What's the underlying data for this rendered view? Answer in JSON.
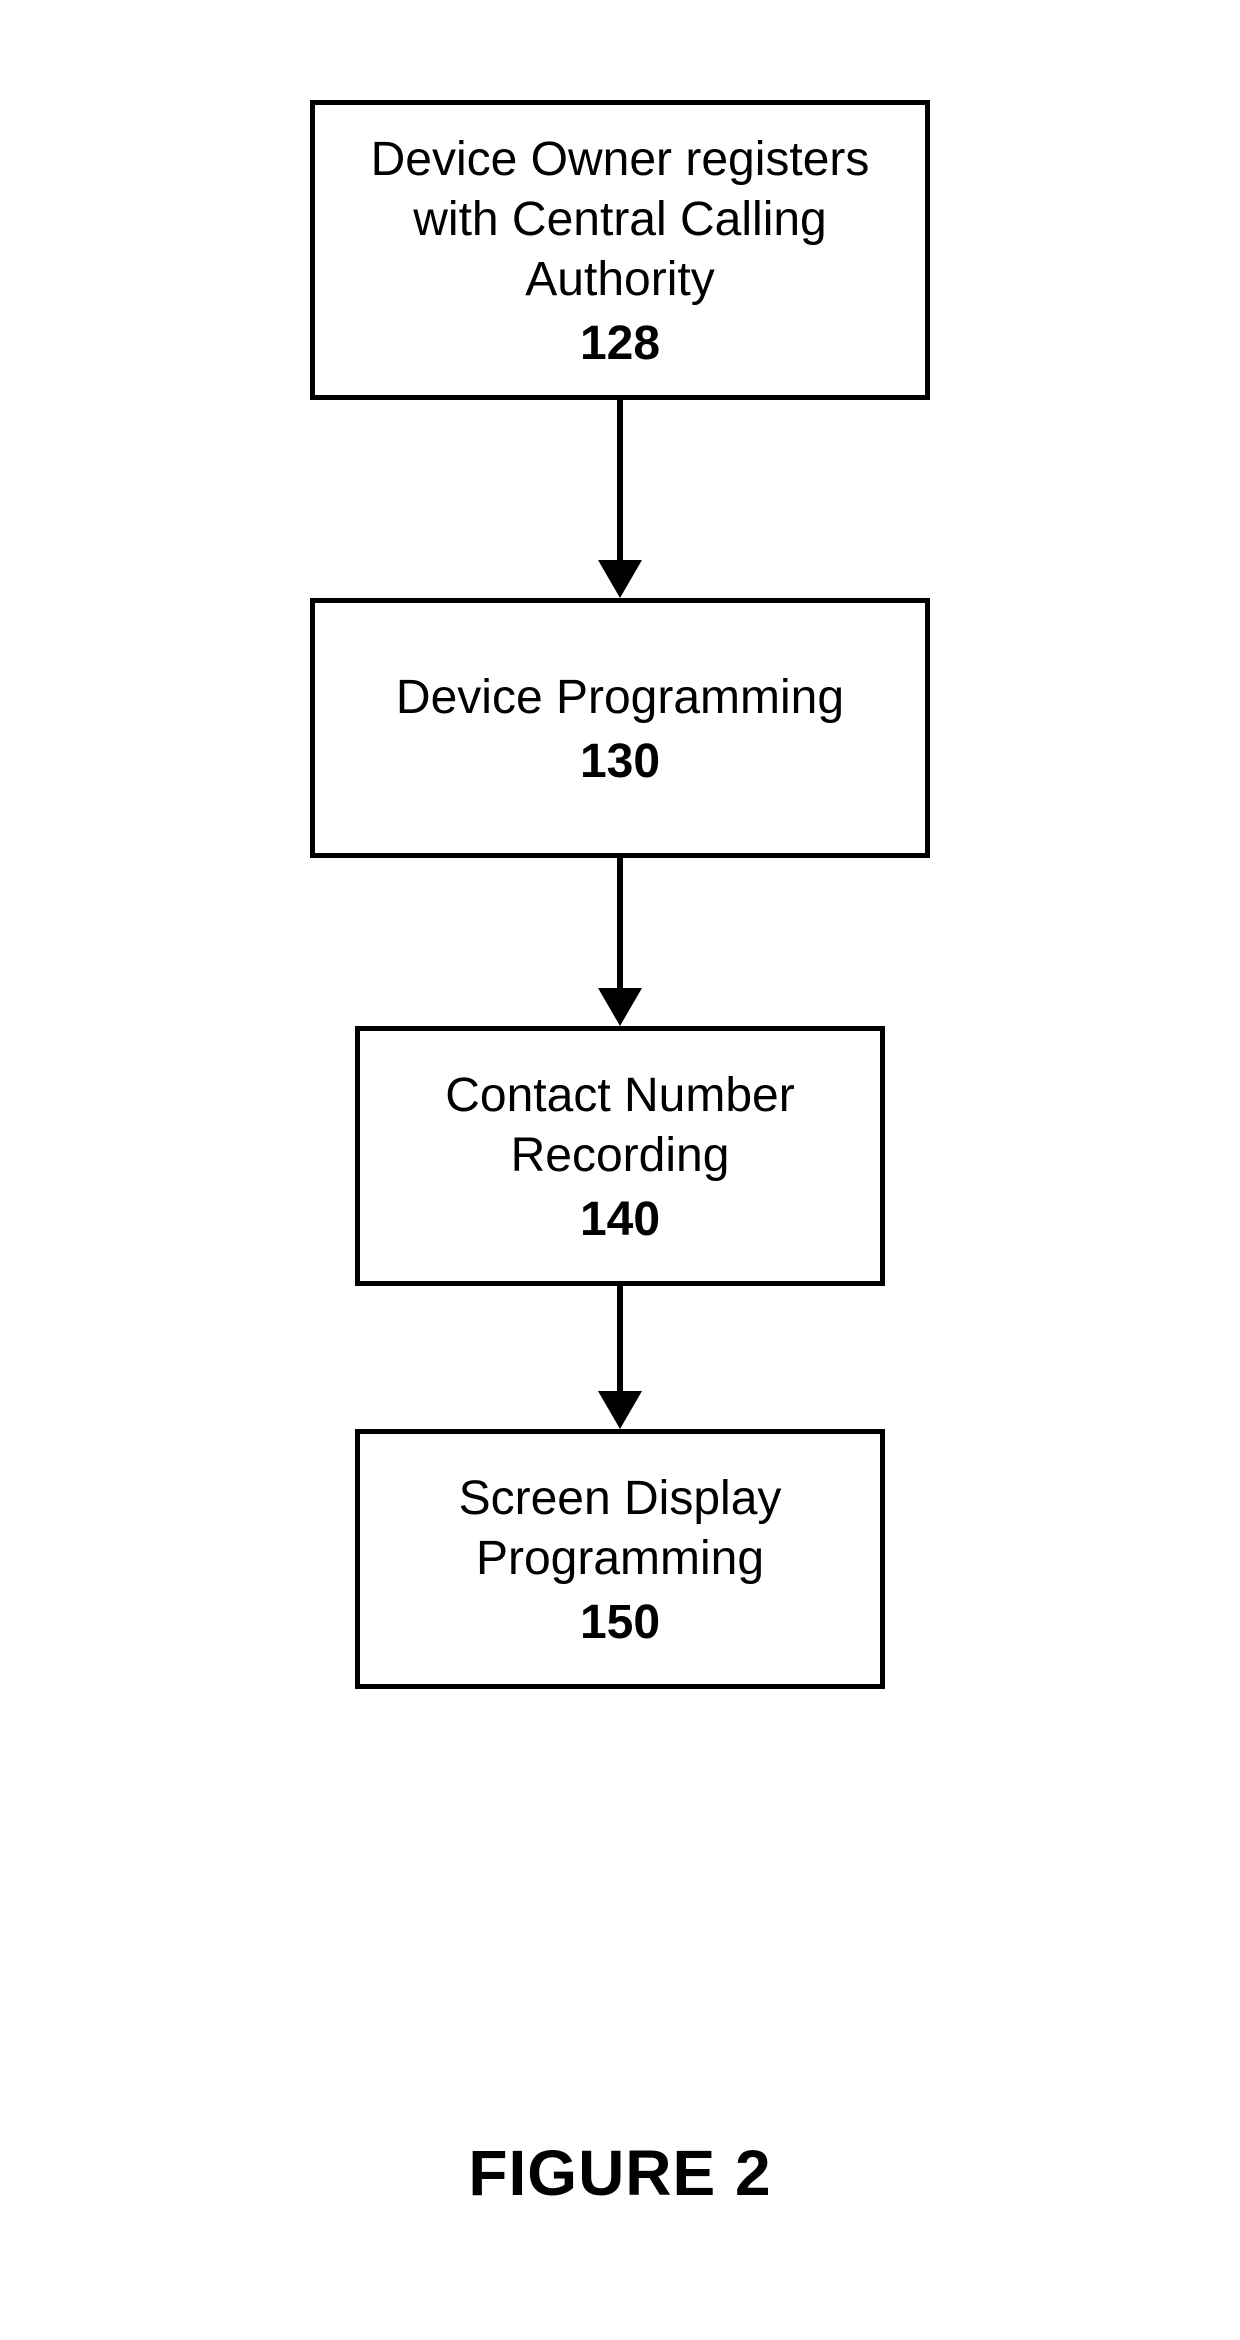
{
  "flowchart": {
    "steps": [
      {
        "label": "Device Owner registers with Central Calling Authority",
        "number": "128"
      },
      {
        "label": "Device Programming",
        "number": "130"
      },
      {
        "label": "Contact Number Recording",
        "number": "140"
      },
      {
        "label": "Screen Display Programming",
        "number": "150"
      }
    ]
  },
  "caption": "FIGURE 2"
}
